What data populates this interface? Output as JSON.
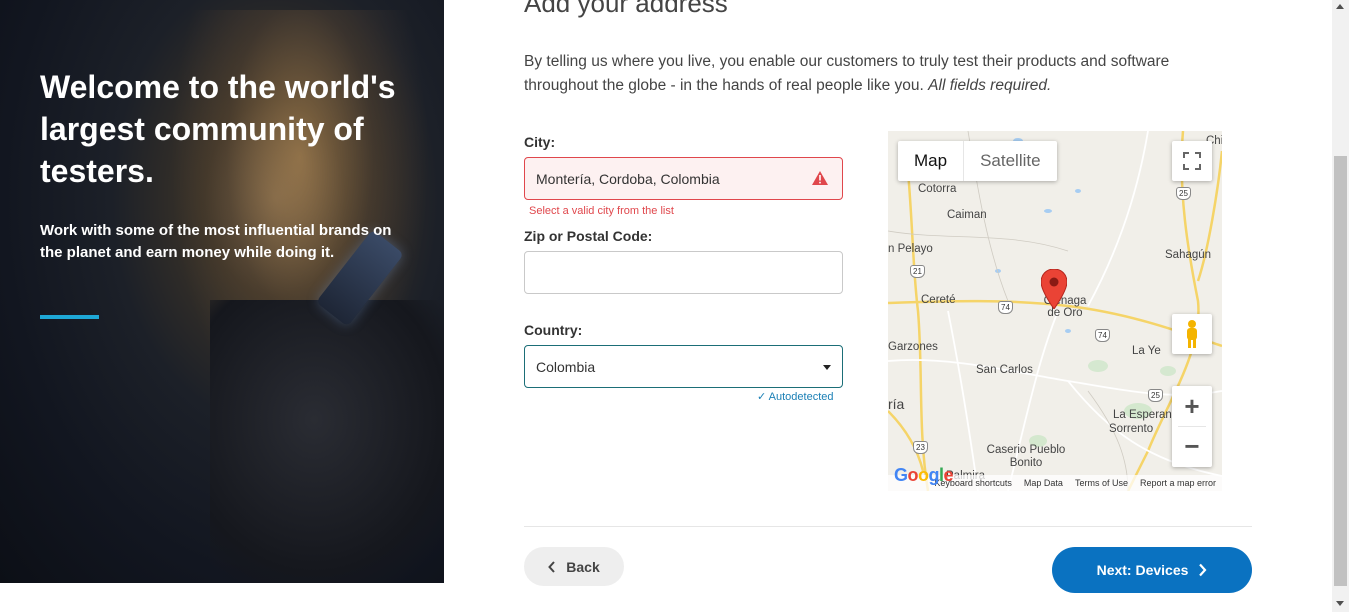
{
  "hero": {
    "title": "Welcome to the world's largest community of testers.",
    "subtitle": "Work with some of the most influential brands on the planet and earn money while doing it."
  },
  "form": {
    "heading": "Add your address",
    "intro": "By telling us where you live, you enable our customers to truly test their products and software throughout the globe - in the hands of real people like you.",
    "intro_required": "All fields required.",
    "city_label": "City:",
    "city_value": "Montería, Cordoba, Colombia",
    "city_error": "Select a valid city from the list",
    "zip_label": "Zip or Postal Code:",
    "zip_value": "",
    "country_label": "Country:",
    "country_value": "Colombia",
    "autodetected": "✓ Autodetected"
  },
  "map": {
    "type_map": "Map",
    "type_satellite": "Satellite",
    "places": [
      "Cotorra",
      "Caiman",
      "n Pelayo",
      "Sahagún",
      "Cereté",
      "Ciénaga de Oro",
      "Garzones",
      "San Carlos",
      "La Ye",
      "ría",
      "La Esperanza",
      "Sorrento",
      "Caserio Pueblo Bonito",
      "Palmira",
      "Chi"
    ],
    "shields": [
      "25",
      "21",
      "74",
      "74",
      "25",
      "23"
    ],
    "footer": [
      "Keyboard shortcuts",
      "Map Data",
      "Terms of Use",
      "Report a map error"
    ],
    "logo": "Google",
    "zoom_in": "+",
    "zoom_out": "−"
  },
  "nav": {
    "back_label": "Back",
    "next_label": "Next: Devices"
  },
  "colors": {
    "accent": "#1ea8d6",
    "primary_button": "#0a72c1",
    "error": "#e0474c",
    "link": "#1a7fb5"
  }
}
